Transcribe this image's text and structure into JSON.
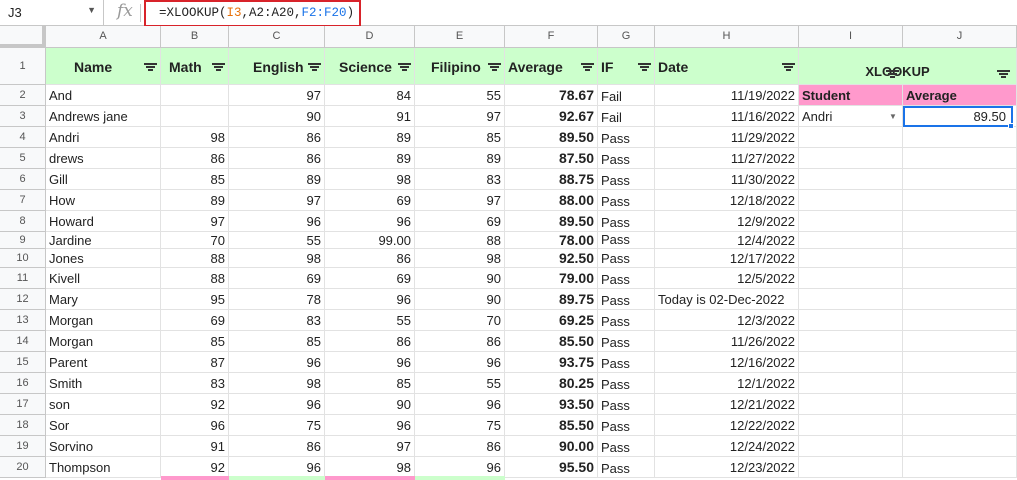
{
  "formula_bar": {
    "name_box": "J3",
    "fx_label": "fx",
    "formula": {
      "prefix": "=XLOOKUP(",
      "ref1": "I3",
      "sep1": ",A2:A20,",
      "ref2": "F2:F20",
      "suffix": ")"
    }
  },
  "columns": [
    "A",
    "B",
    "C",
    "D",
    "E",
    "F",
    "G",
    "H",
    "I",
    "J"
  ],
  "headers": [
    "Name",
    "Math",
    "English",
    "Science",
    "Filipino",
    "Average",
    "IF",
    "Date"
  ],
  "lookup": {
    "title": "XLOOKUP",
    "student_label": "Student",
    "average_label": "Average",
    "student_value": "Andri",
    "average_value": "89.50"
  },
  "rows": [
    {
      "num": "1"
    },
    {
      "num": "2",
      "name": "And",
      "math": "",
      "english": "97",
      "science": "84",
      "filipino": "55",
      "average": "78.67",
      "if": "Fail",
      "date": "11/19/2022"
    },
    {
      "num": "3",
      "name": "Andrews jane",
      "math": "",
      "english": "90",
      "science": "91",
      "filipino": "97",
      "average": "92.67",
      "if": "Fail",
      "date": "11/16/2022"
    },
    {
      "num": "4",
      "name": "Andri",
      "math": "98",
      "english": "86",
      "science": "89",
      "filipino": "85",
      "average": "89.50",
      "if": "Pass",
      "date": "11/29/2022"
    },
    {
      "num": "5",
      "name": "drews",
      "math": "86",
      "english": "86",
      "science": "89",
      "filipino": "89",
      "average": "87.50",
      "if": "Pass",
      "date": "11/27/2022"
    },
    {
      "num": "6",
      "name": "Gill",
      "math": "85",
      "english": "89",
      "science": "98",
      "filipino": "83",
      "average": "88.75",
      "if": "Pass",
      "date": "11/30/2022"
    },
    {
      "num": "7",
      "name": "How",
      "math": "89",
      "english": "97",
      "science": "69",
      "filipino": "97",
      "average": "88.00",
      "if": "Pass",
      "date": "12/18/2022"
    },
    {
      "num": "8",
      "name": "Howard",
      "math": "97",
      "english": "96",
      "science": "96",
      "filipino": "69",
      "average": "89.50",
      "if": "Pass",
      "date": "12/9/2022"
    },
    {
      "num": "9",
      "name": "Jardine",
      "math": "70",
      "english": "55",
      "science": "99.00",
      "filipino": "88",
      "average": "78.00",
      "if": "Pass",
      "date": "12/4/2022"
    },
    {
      "num": "10",
      "name": "Jones",
      "math": "88",
      "english": "98",
      "science": "86",
      "filipino": "98",
      "average": "92.50",
      "if": "Pass",
      "date": "12/17/2022"
    },
    {
      "num": "11",
      "name": "Kivell",
      "math": "88",
      "english": "69",
      "science": "69",
      "filipino": "90",
      "average": "79.00",
      "if": "Pass",
      "date": "12/5/2022"
    },
    {
      "num": "12",
      "name": "Mary",
      "math": "95",
      "english": "78",
      "science": "96",
      "filipino": "90",
      "average": "89.75",
      "if": "Pass",
      "date": "Today is 02-Dec-2022"
    },
    {
      "num": "13",
      "name": "Morgan",
      "math": "69",
      "english": "83",
      "science": "55",
      "filipino": "70",
      "average": "69.25",
      "if": "Pass",
      "date": "12/3/2022"
    },
    {
      "num": "14",
      "name": "Morgan",
      "math": "85",
      "english": "85",
      "science": "86",
      "filipino": "86",
      "average": "85.50",
      "if": "Pass",
      "date": "11/26/2022"
    },
    {
      "num": "15",
      "name": "Parent",
      "math": "87",
      "english": "96",
      "science": "96",
      "filipino": "96",
      "average": "93.75",
      "if": "Pass",
      "date": "12/16/2022"
    },
    {
      "num": "16",
      "name": "Smith",
      "math": "83",
      "english": "98",
      "science": "85",
      "filipino": "55",
      "average": "80.25",
      "if": "Pass",
      "date": "12/1/2022"
    },
    {
      "num": "17",
      "name": "son",
      "math": "92",
      "english": "96",
      "science": "90",
      "filipino": "96",
      "average": "93.50",
      "if": "Pass",
      "date": "12/21/2022"
    },
    {
      "num": "18",
      "name": "Sor",
      "math": "96",
      "english": "75",
      "science": "96",
      "filipino": "75",
      "average": "85.50",
      "if": "Pass",
      "date": "12/22/2022"
    },
    {
      "num": "19",
      "name": "Sorvino",
      "math": "91",
      "english": "86",
      "science": "97",
      "filipino": "86",
      "average": "90.00",
      "if": "Pass",
      "date": "12/24/2022"
    },
    {
      "num": "20",
      "name": "Thompson",
      "math": "92",
      "english": "96",
      "science": "98",
      "filipino": "96",
      "average": "95.50",
      "if": "Pass",
      "date": "12/23/2022"
    }
  ],
  "colors": {
    "header_green": "#ccffcc",
    "lookup_pink": "#ff99cc",
    "formula_highlight": "#d8232a",
    "selection_blue": "#1a73e8"
  }
}
